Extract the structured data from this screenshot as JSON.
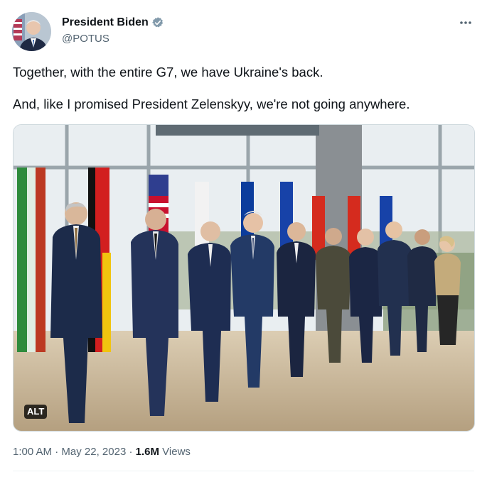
{
  "author": {
    "name": "President Biden",
    "handle": "@POTUS",
    "verified": true,
    "verified_color": "#829aab"
  },
  "more_icon": "more-horizontal-icon",
  "tweet_text": {
    "line1": "Together, with the entire G7, we have Ukraine's back.",
    "line2": "And, like I promised President Zelenskyy, we're not going anywhere."
  },
  "media": {
    "description_icon": "photo",
    "alt_badge": "ALT"
  },
  "meta": {
    "time": "1:00 AM",
    "separator": "·",
    "date": "May 22, 2023",
    "views_count": "1.6M",
    "views_label": "Views"
  },
  "colors": {
    "text_primary": "#0f1419",
    "text_secondary": "#536471",
    "border": "#cfd9de"
  }
}
